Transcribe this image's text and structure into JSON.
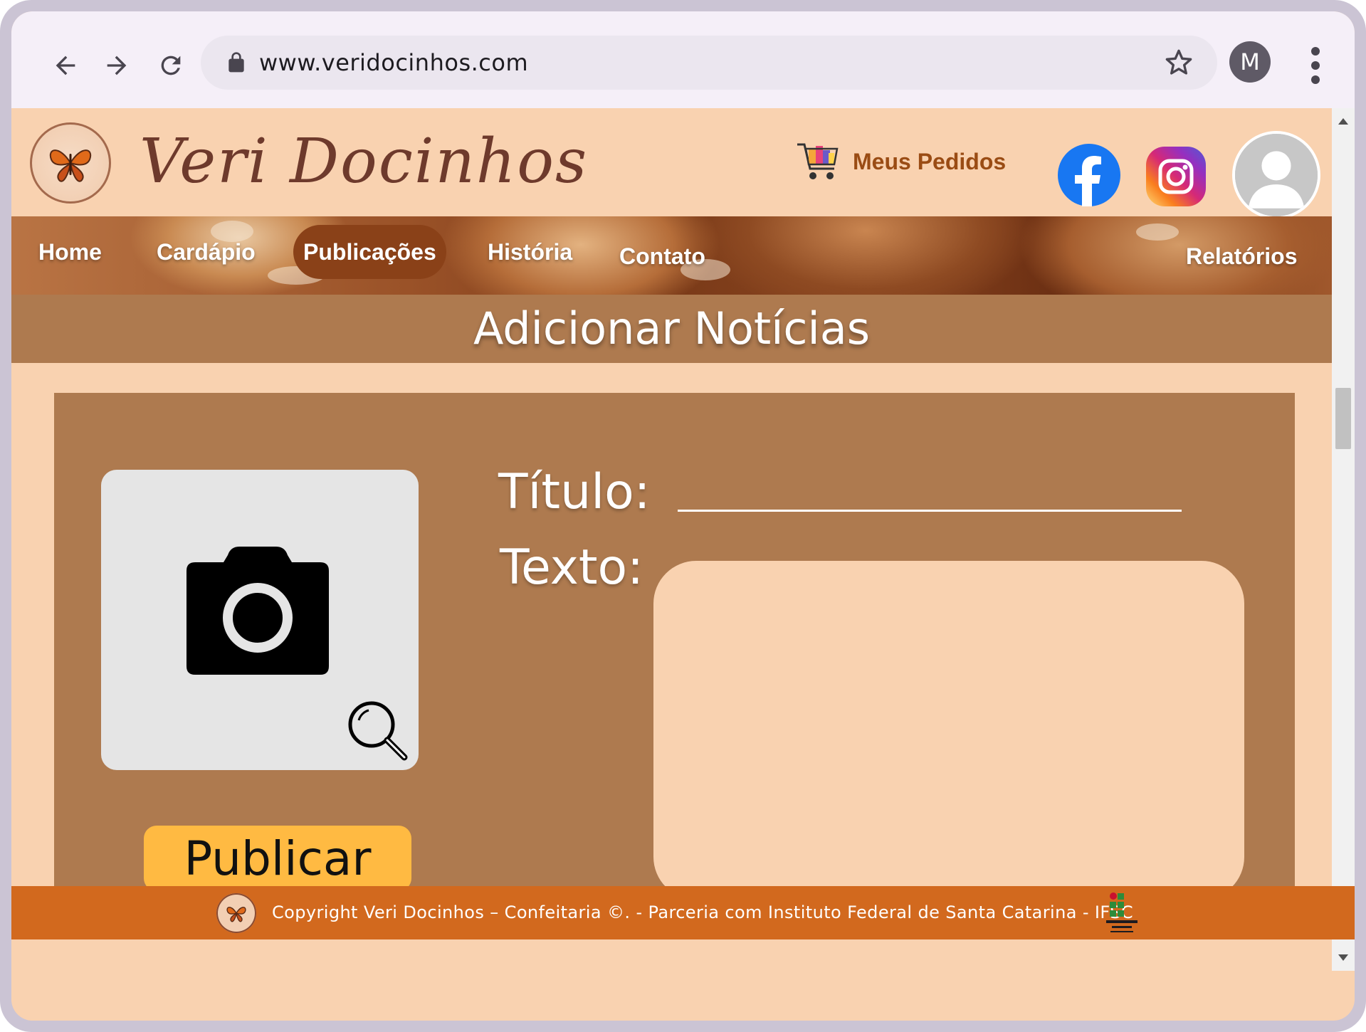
{
  "browser": {
    "url": "www.veridocinhos.com",
    "profile_initial": "M"
  },
  "header": {
    "brand": "Veri Docinhos",
    "orders_label": "Meus Pedidos"
  },
  "nav": {
    "items": [
      {
        "label": "Home"
      },
      {
        "label": "Cardápio"
      },
      {
        "label": "Publicações",
        "active": true
      },
      {
        "label": "História"
      },
      {
        "label": "Contato"
      },
      {
        "label": "Relatórios"
      }
    ]
  },
  "section": {
    "title": "Adicionar Notícias"
  },
  "form": {
    "title_label": "Título:",
    "text_label": "Texto:",
    "publish_label": "Publicar",
    "title_value": "",
    "text_value": ""
  },
  "footer": {
    "text": "Copyright Veri Docinhos – Confeitaria ©. - Parceria com Instituto Federal de Santa Catarina - IFSC",
    "ifsc_logo_text": "INSTITUTO FEDERAL Santa Catarina"
  },
  "colors": {
    "page_bg": "#f9d2b0",
    "section_bg": "#ae7a4f",
    "active_nav": "#8a4118",
    "publish_button": "#ffba42",
    "footer_bg": "#d2691e",
    "brand_text": "#6e3a2c"
  },
  "icons": [
    "back-arrow-icon",
    "forward-arrow-icon",
    "reload-icon",
    "lock-icon",
    "star-icon",
    "kebab-menu-icon",
    "shopping-cart-icon",
    "facebook-icon",
    "instagram-icon",
    "user-avatar-icon",
    "camera-icon",
    "magnifier-icon",
    "butterfly-logo-icon",
    "ifsc-logo-icon"
  ]
}
